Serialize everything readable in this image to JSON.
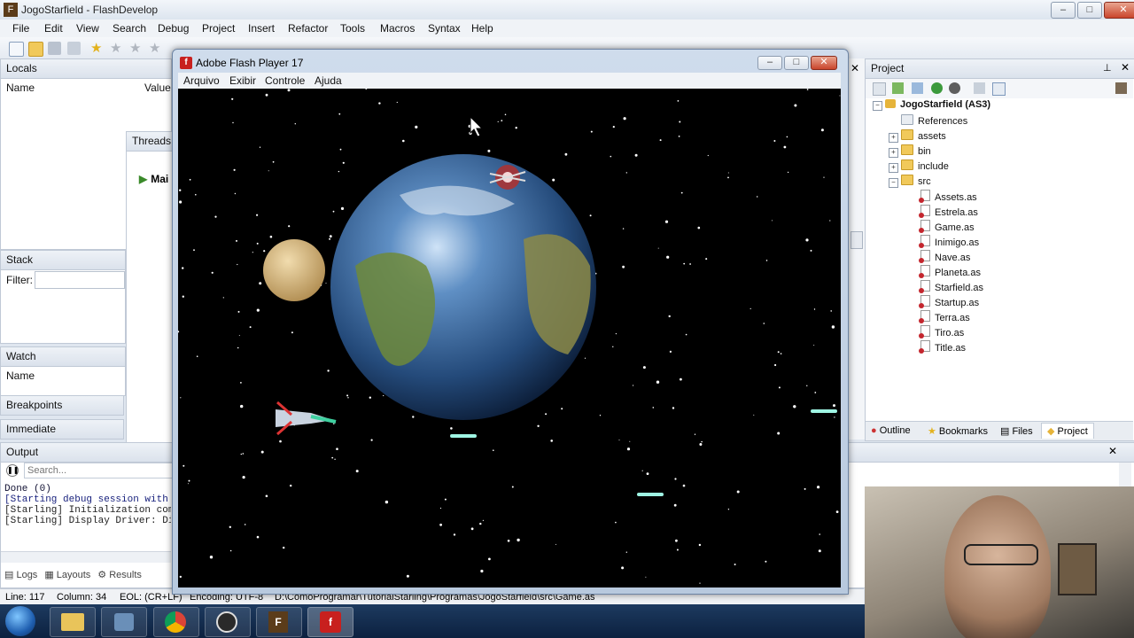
{
  "window": {
    "title": "JogoStarfield - FlashDevelop",
    "menu": [
      "File",
      "Edit",
      "View",
      "Search",
      "Debug",
      "Project",
      "Insert",
      "Refactor",
      "Tools",
      "Macros",
      "Syntax",
      "Help"
    ]
  },
  "locals": {
    "title": "Locals",
    "col_name": "Name",
    "col_value": "Value"
  },
  "threads": {
    "title": "Threads",
    "item": "Mai"
  },
  "stack": {
    "title": "Stack",
    "filter_label": "Filter:"
  },
  "watch": {
    "title": "Watch",
    "col_name": "Name"
  },
  "breakpoints": {
    "title": "Breakpoints"
  },
  "immediate": {
    "title": "Immediate"
  },
  "output": {
    "title": "Output",
    "search_placeholder": "Search...",
    "lines": [
      "Done (0)",
      "[Starting debug session with",
      "[Starling] Initialization com",
      "[Starling] Display Driver: Di"
    ],
    "tabs": [
      "Logs",
      "Layouts",
      "Results"
    ]
  },
  "flash": {
    "title": "Adobe Flash Player 17",
    "menu": [
      "Arquivo",
      "Exibir",
      "Controle",
      "Ajuda"
    ]
  },
  "project": {
    "title": "Project",
    "root": "JogoStarfield (AS3)",
    "folders": [
      "References",
      "assets",
      "bin",
      "include",
      "src"
    ],
    "files": [
      "Assets.as",
      "Estrela.as",
      "Game.as",
      "Inimigo.as",
      "Nave.as",
      "Planeta.as",
      "Starfield.as",
      "Startup.as",
      "Terra.as",
      "Tiro.as",
      "Title.as"
    ],
    "tabs": [
      "Outline",
      "Bookmarks",
      "Files",
      "Project"
    ]
  },
  "status": {
    "line": "Line: 117",
    "column": "Column: 34",
    "eol": "EOL: (CR+LF)",
    "encoding": "Encoding: UTF-8",
    "path": "D:\\ComoProgramar\\TutorialStarling\\Programas\\JogoStarfield\\src\\Game.as"
  },
  "colors": {
    "accent": "#c8201e",
    "stage": "#000000",
    "planet_blue": "#2f5d96",
    "moon": "#d8b97a"
  }
}
